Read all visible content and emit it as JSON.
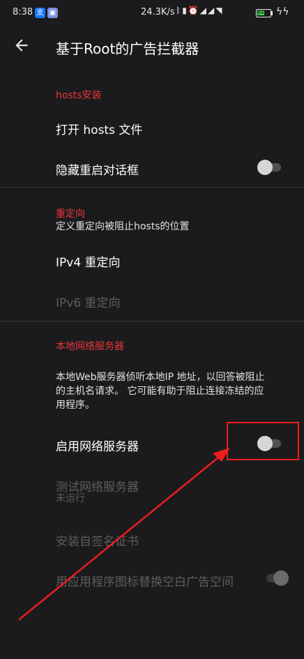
{
  "status_bar": {
    "time": "8:38",
    "app_icons": [
      "alipay-icon",
      "notification-app-icon"
    ],
    "network_speed": "24.3K/s",
    "indicators": [
      "bluetooth-icon",
      "battery-saver-icon",
      "alarm-icon",
      "hd-signal-icon",
      "hd-signal-icon",
      "wifi-icon"
    ],
    "battery_level": "64",
    "accent_battery": "#3ccf4e"
  },
  "app_bar": {
    "title": "基于Root的广告拦截器",
    "back_icon": "arrow-back-icon"
  },
  "sections": {
    "hosts": {
      "header": "hosts安装",
      "open_hosts": "打开 hosts 文件",
      "hide_restart_dialog": "隐藏重启对话框",
      "hide_restart_dialog_on": false
    },
    "redirect": {
      "header": "重定向",
      "summary": "定义重定向被阻止hosts的位置",
      "ipv4": "IPv4 重定向",
      "ipv6": "IPv6 重定向"
    },
    "webserver": {
      "header": "本地网络服务器",
      "description_line1": "本地Web服务器侦听本地IP 地址，以回答被阻止",
      "description_line2": "的主机名请求。 它可能有助于阻止连接冻结的应",
      "description_line3": "用程序。",
      "enable": "启用网络服务器",
      "enable_on": false,
      "test": "测试网络服务器",
      "test_status": "未运行",
      "install_cert": "安装自签名证书",
      "replace_icons": "用应用程序图标替换空白广告空间",
      "replace_icons_on": true
    }
  },
  "colors": {
    "background": "#1b1b1d",
    "section_header": "#e8353a",
    "annotation_red": "#ee1d1d",
    "disabled_text": "#5d5d60"
  }
}
